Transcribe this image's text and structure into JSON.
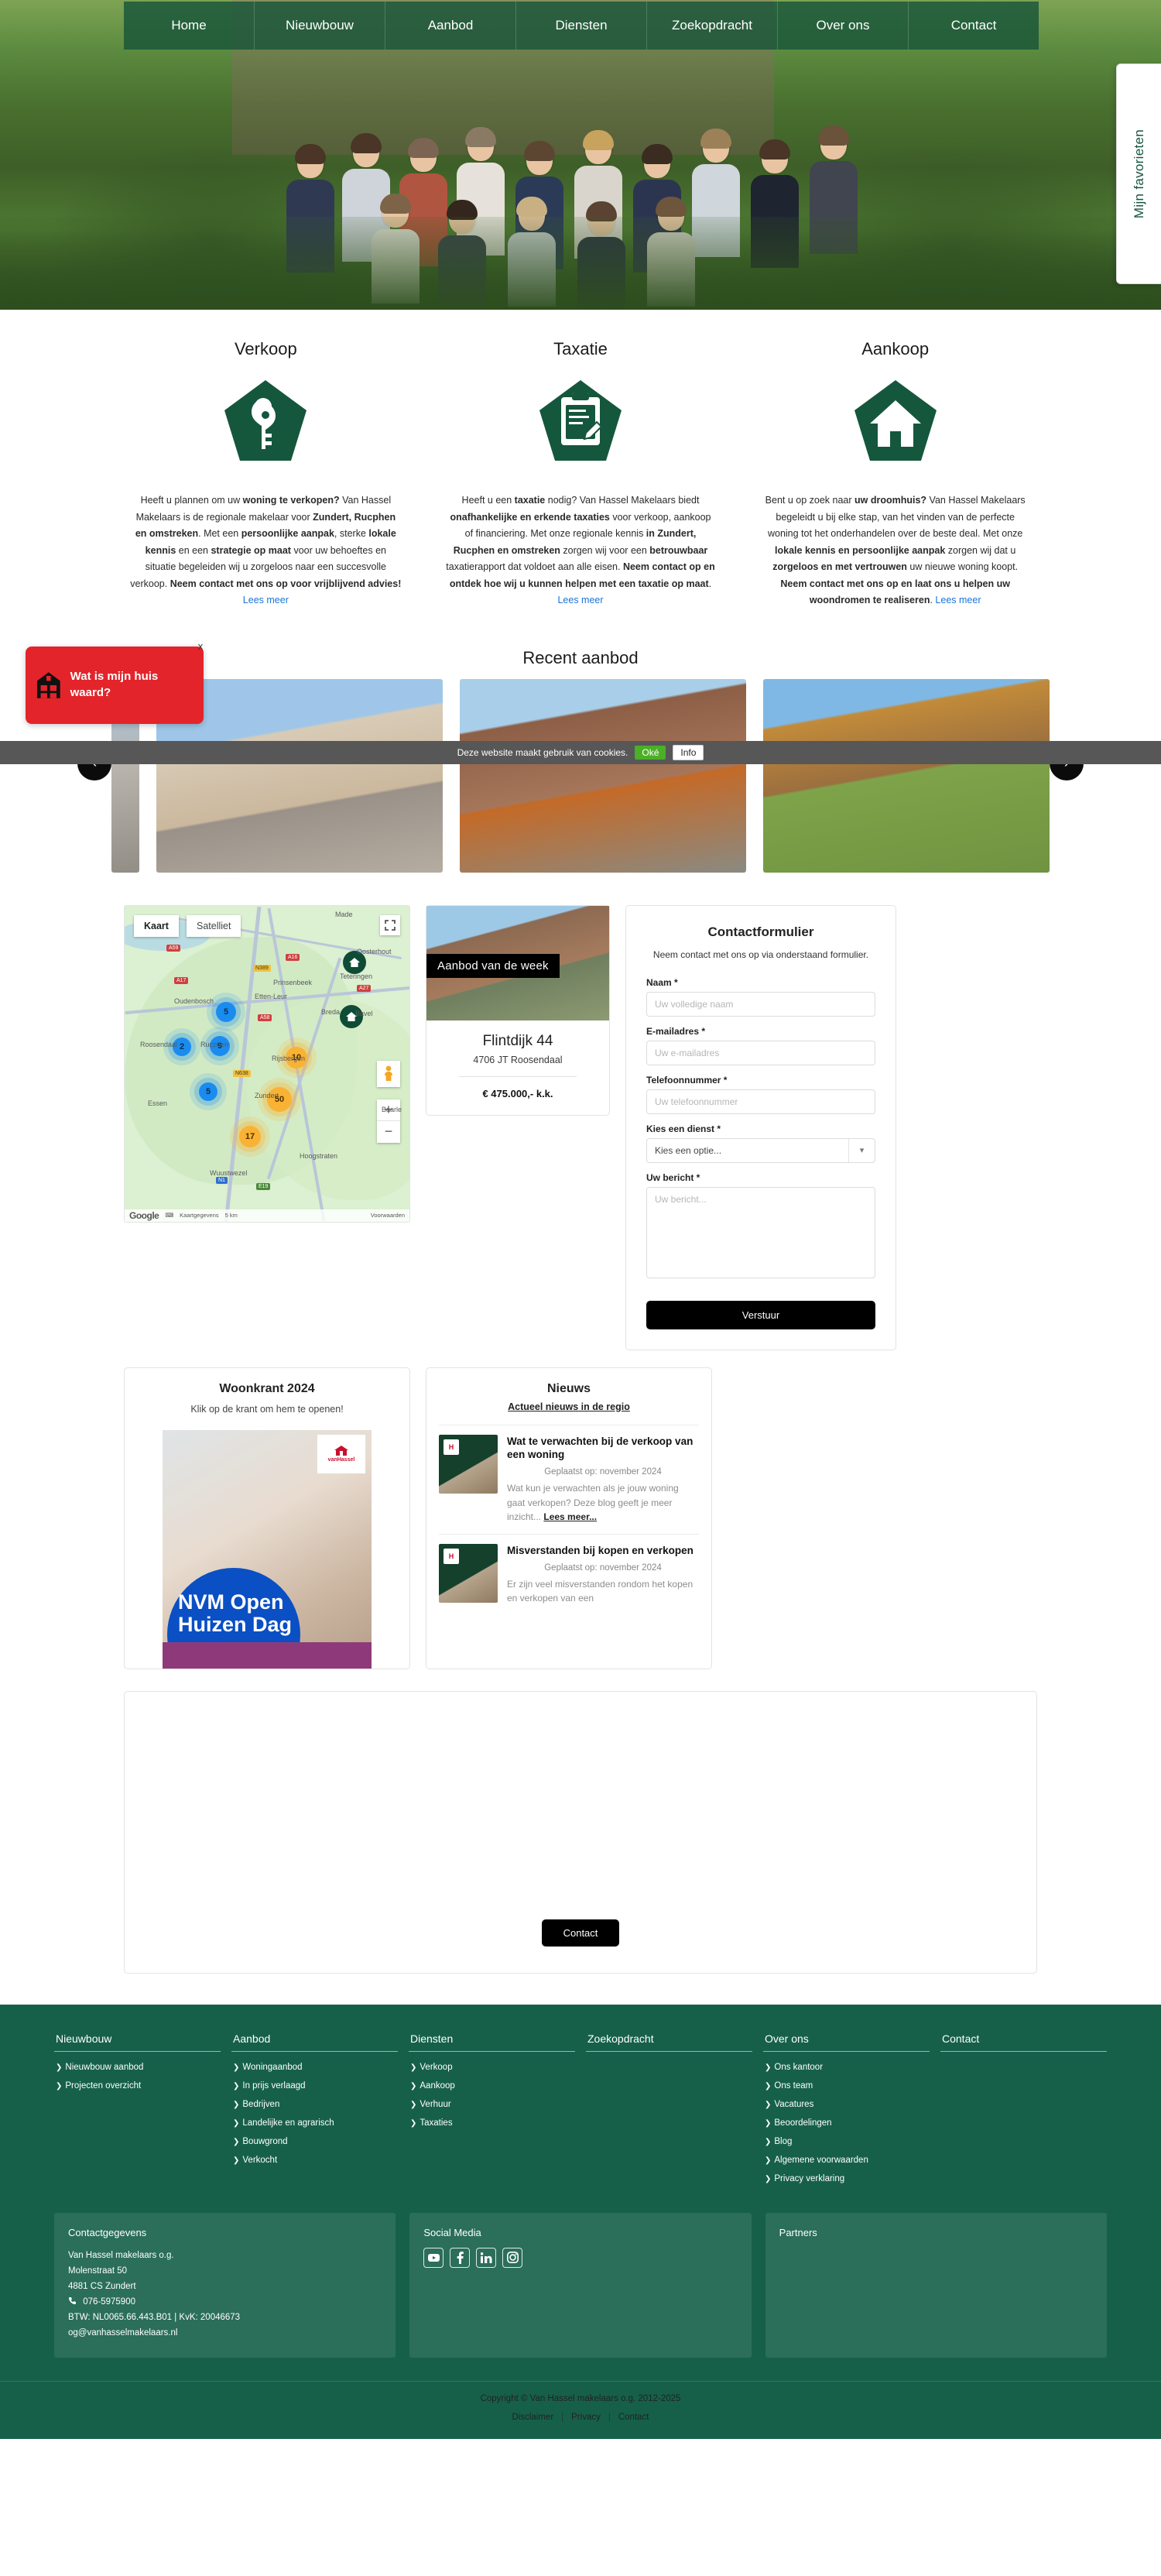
{
  "nav": {
    "items": [
      {
        "label": "Home"
      },
      {
        "label": "Nieuwbouw"
      },
      {
        "label": "Aanbod"
      },
      {
        "label": "Diensten"
      },
      {
        "label": "Zoekopdracht"
      },
      {
        "label": "Over ons"
      },
      {
        "label": "Contact"
      }
    ]
  },
  "favorites_tab": {
    "label": "Mijn favorieten"
  },
  "services": [
    {
      "title": "Verkoop",
      "icon": "key-in-pentagon-icon",
      "text_html": "Heeft u plannen om uw <b>woning te verkopen?</b> Van Hassel Makelaars is de regionale makelaar voor <b>Zundert, Rucphen en omstreken</b>. Met een <b>persoonlijke aanpak</b>, sterke <b>lokale kennis</b> en een <b>strategie op maat</b> voor uw behoeftes en situatie begeleiden wij u zorgeloos naar een succesvolle verkoop. <b>Neem contact met ons op voor vrijblijvend advies!</b> ",
      "link_label": "Lees meer"
    },
    {
      "title": "Taxatie",
      "icon": "clipboard-pen-in-pentagon-icon",
      "text_html": "Heeft u een <b>taxatie</b> nodig? Van Hassel Makelaars biedt <b>onafhankelijke en erkende taxaties</b> voor verkoop, aankoop of financiering. Met onze regionale kennis <b>in Zundert, Rucphen en omstreken</b> zorgen wij voor een <b>betrouwbaar</b> taxatierapport dat voldoet aan alle eisen. <b>Neem contact op en ontdek hoe wij u kunnen helpen met een taxatie op maat</b>. ",
      "link_label": "Lees meer"
    },
    {
      "title": "Aankoop",
      "icon": "house-in-pentagon-icon",
      "text_html": "Bent u op zoek naar <b>uw droomhuis?</b> Van Hassel Makelaars begeleidt u bij elke stap, van het vinden van de perfecte woning tot het onderhandelen over de beste deal. Met onze <b>lokale kennis en persoonlijke aanpak</b> zorgen wij dat u <b>zorgeloos en met vertrouwen</b> uw nieuwe woning koopt. <b>Neem contact met ons op en laat ons u helpen uw woondromen te realiseren</b>. ",
      "link_label": "Lees meer"
    }
  ],
  "huiswaard": {
    "title": "Wat is mijn huis waard?",
    "close_label": "x",
    "icon": "house-icon"
  },
  "cookiebar": {
    "text": "Deze website maakt gebruik van cookies.",
    "accept_label": "Oké",
    "info_label": "Info"
  },
  "recent": {
    "title": "Recent aanbod",
    "prev_label": "‹",
    "next_label": "›",
    "slides": [
      {
        "alt": "woning-foto-1"
      },
      {
        "alt": "woning-foto-2"
      },
      {
        "alt": "woning-foto-3"
      }
    ]
  },
  "map": {
    "type_kaart": "Kaart",
    "type_satelliet": "Satelliet",
    "zoom_in": "+",
    "zoom_out": "−",
    "clusters": [
      {
        "count": "5",
        "style": "blue"
      },
      {
        "count": "2",
        "style": "blue"
      },
      {
        "count": "9",
        "style": "blue"
      },
      {
        "count": "5",
        "style": "blue"
      },
      {
        "count": "10",
        "style": "orange"
      },
      {
        "count": "50",
        "style": "orange"
      },
      {
        "count": "17",
        "style": "orange"
      }
    ],
    "labels": [
      "Made",
      "Oosterhout",
      "Teteringen",
      "Prinsenbeek",
      "Etten-Leur",
      "Oudenbosch",
      "Roosendaal",
      "Rucphen",
      "Rijsbergen",
      "Zundert",
      "Essen",
      "Wuustwezel",
      "Hoogstraten",
      "Breda",
      "Bavel",
      "Baarle"
    ],
    "roads": [
      "A59",
      "A17",
      "A16",
      "N389",
      "A58",
      "A27",
      "N638",
      "N1",
      "E19"
    ],
    "footer": {
      "attribution": "Kaartgegevens",
      "scale": "5 km",
      "terms": "Voorwaarden"
    }
  },
  "week": {
    "badge": "Aanbod van de week",
    "address": "Flintdijk 44",
    "postal_city": "4706 JT Roosendaal",
    "price": "€ 475.000,- k.k."
  },
  "form": {
    "title": "Contactformulier",
    "subtitle": "Neem contact met ons op via onderstaand formulier.",
    "fields": {
      "name_label": "Naam *",
      "name_placeholder": "Uw volledige naam",
      "email_label": "E-mailadres *",
      "email_placeholder": "Uw e-mailadres",
      "phone_label": "Telefoonnummer *",
      "phone_placeholder": "Uw telefoonnummer",
      "service_label": "Kies een dienst *",
      "service_value": "Kies een optie...",
      "message_label": "Uw bericht *",
      "message_placeholder": "Uw bericht..."
    },
    "submit_label": "Verstuur"
  },
  "krant": {
    "title": "Woonkrant 2024",
    "subtitle": "Klik op de krant om hem te openen!",
    "cover_headline": "NVM Open Huizen Dag",
    "cover_logo": "vanHassel"
  },
  "nieuws": {
    "title": "Nieuws",
    "subtitle": "Actueel nieuws in de regio",
    "items": [
      {
        "headline": "Wat te verwachten bij de verkoop van een woning",
        "date": "Geplaatst op: november 2024",
        "excerpt": "Wat kun je verwachten als je jouw woning gaat verkopen? Deze blog geeft je meer inzicht...",
        "more_label": "Lees meer..."
      },
      {
        "headline": "Misverstanden bij kopen en verkopen",
        "date": "Geplaatst op: november 2024",
        "excerpt": "Er zijn veel misverstanden rondom het kopen en verkopen van een",
        "more_label": ""
      }
    ]
  },
  "contact_section": {
    "button_label": "Contact"
  },
  "footer": {
    "columns": [
      {
        "title": "Nieuwbouw",
        "links": [
          "Nieuwbouw aanbod",
          "Projecten overzicht"
        ]
      },
      {
        "title": "Aanbod",
        "links": [
          "Woningaanbod",
          "In prijs verlaagd",
          "Bedrijven",
          "Landelijke en agrarisch",
          "Bouwgrond",
          "Verkocht"
        ]
      },
      {
        "title": "Diensten",
        "links": [
          "Verkoop",
          "Aankoop",
          "Verhuur",
          "Taxaties"
        ]
      },
      {
        "title": "Zoekopdracht",
        "links": []
      },
      {
        "title": "Over ons",
        "links": [
          "Ons kantoor",
          "Ons team",
          "Vacatures",
          "Beoordelingen",
          "Blog",
          "Algemene voorwaarden",
          "Privacy verklaring"
        ]
      },
      {
        "title": "Contact",
        "links": []
      }
    ],
    "contact_panel": {
      "title": "Contactgegevens",
      "company": "Van Hassel makelaars o.g.",
      "street": "Molenstraat 50",
      "city": "4881 CS Zundert",
      "phone": "076-5975900",
      "registration": "BTW: NL0065.66.443.B01 | KvK: 20046673",
      "email": "og@vanhasselmakelaars.nl"
    },
    "social_panel": {
      "title": "Social Media",
      "icons": [
        "youtube-icon",
        "facebook-icon",
        "linkedin-icon",
        "instagram-icon"
      ]
    },
    "partners_panel": {
      "title": "Partners"
    },
    "copyright": "Copyright © Van Hassel makelaars o.g. 2012-2025",
    "bottom_links": [
      "Disclaimer",
      "Privacy",
      "Contact"
    ]
  }
}
